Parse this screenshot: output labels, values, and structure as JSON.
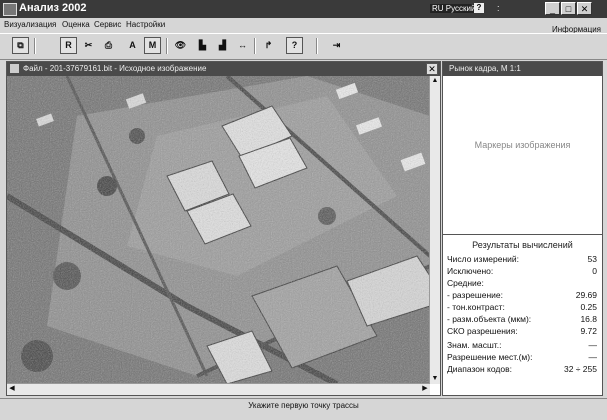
{
  "window": {
    "title": "Анализ 2002",
    "language": "RU Русский",
    "help_glyph": "?",
    "tray_glyph": ":",
    "min_glyph": "_",
    "max_glyph": "□",
    "close_glyph": "✕"
  },
  "menu": {
    "items": [
      "Визуализация",
      "Оценка",
      "Сервис",
      "Настройки"
    ],
    "info": "Информация"
  },
  "toolbar": {
    "buttons": [
      {
        "icon": "open-window-icon",
        "glyph": "⧉"
      },
      {
        "icon": "empty-icon",
        "glyph": ""
      },
      {
        "icon": "r-icon",
        "glyph": "R"
      },
      {
        "icon": "scissors-icon",
        "glyph": "✂"
      },
      {
        "icon": "print-icon",
        "glyph": "⎙"
      },
      {
        "icon": "a-icon",
        "glyph": "A"
      },
      {
        "icon": "m-icon",
        "glyph": "M"
      },
      {
        "icon": "eye-icon",
        "glyph": "👁"
      },
      {
        "icon": "bar-chart-icon",
        "glyph": "▙"
      },
      {
        "icon": "bar-chart-2-icon",
        "glyph": "▟"
      },
      {
        "icon": "width-icon",
        "glyph": "↔"
      },
      {
        "icon": "corner-arrow-icon",
        "glyph": "↱"
      },
      {
        "icon": "help-icon",
        "glyph": "?"
      },
      {
        "icon": "exit-icon",
        "glyph": "⇥"
      }
    ]
  },
  "image_pane": {
    "title": "Файл - 201-37679161.bit - Исходное изображение",
    "close_glyph": "✕",
    "scroll_up": "▲",
    "scroll_down": "▼",
    "scroll_left": "◀",
    "scroll_right": "▶"
  },
  "right_panel": {
    "title": "Рынок кадра, М 1:1",
    "markers_label": "Маркеры изображения"
  },
  "results": {
    "title": "Результаты вычислений",
    "rows": [
      {
        "label": "Число измерений:",
        "value": "53"
      },
      {
        "label": "Исключено:",
        "value": "0"
      },
      {
        "label": "Средние:",
        "value": ""
      },
      {
        "label": "- разрешение:",
        "value": "29.69"
      },
      {
        "label": "- тон.контраст:",
        "value": "0.25"
      },
      {
        "label": "- разм.объекта (мкм):",
        "value": "16.8"
      },
      {
        "label": "СКО разрешения:",
        "value": "9.72"
      },
      {
        "label": "Знам. масшт.:",
        "value": "—"
      },
      {
        "label": "Разрешение мест.(м):",
        "value": "—"
      },
      {
        "label": "Диапазон кодов:",
        "value": "32 ÷ 255"
      }
    ]
  },
  "status": {
    "text": "Укажите первую точку трассы"
  }
}
